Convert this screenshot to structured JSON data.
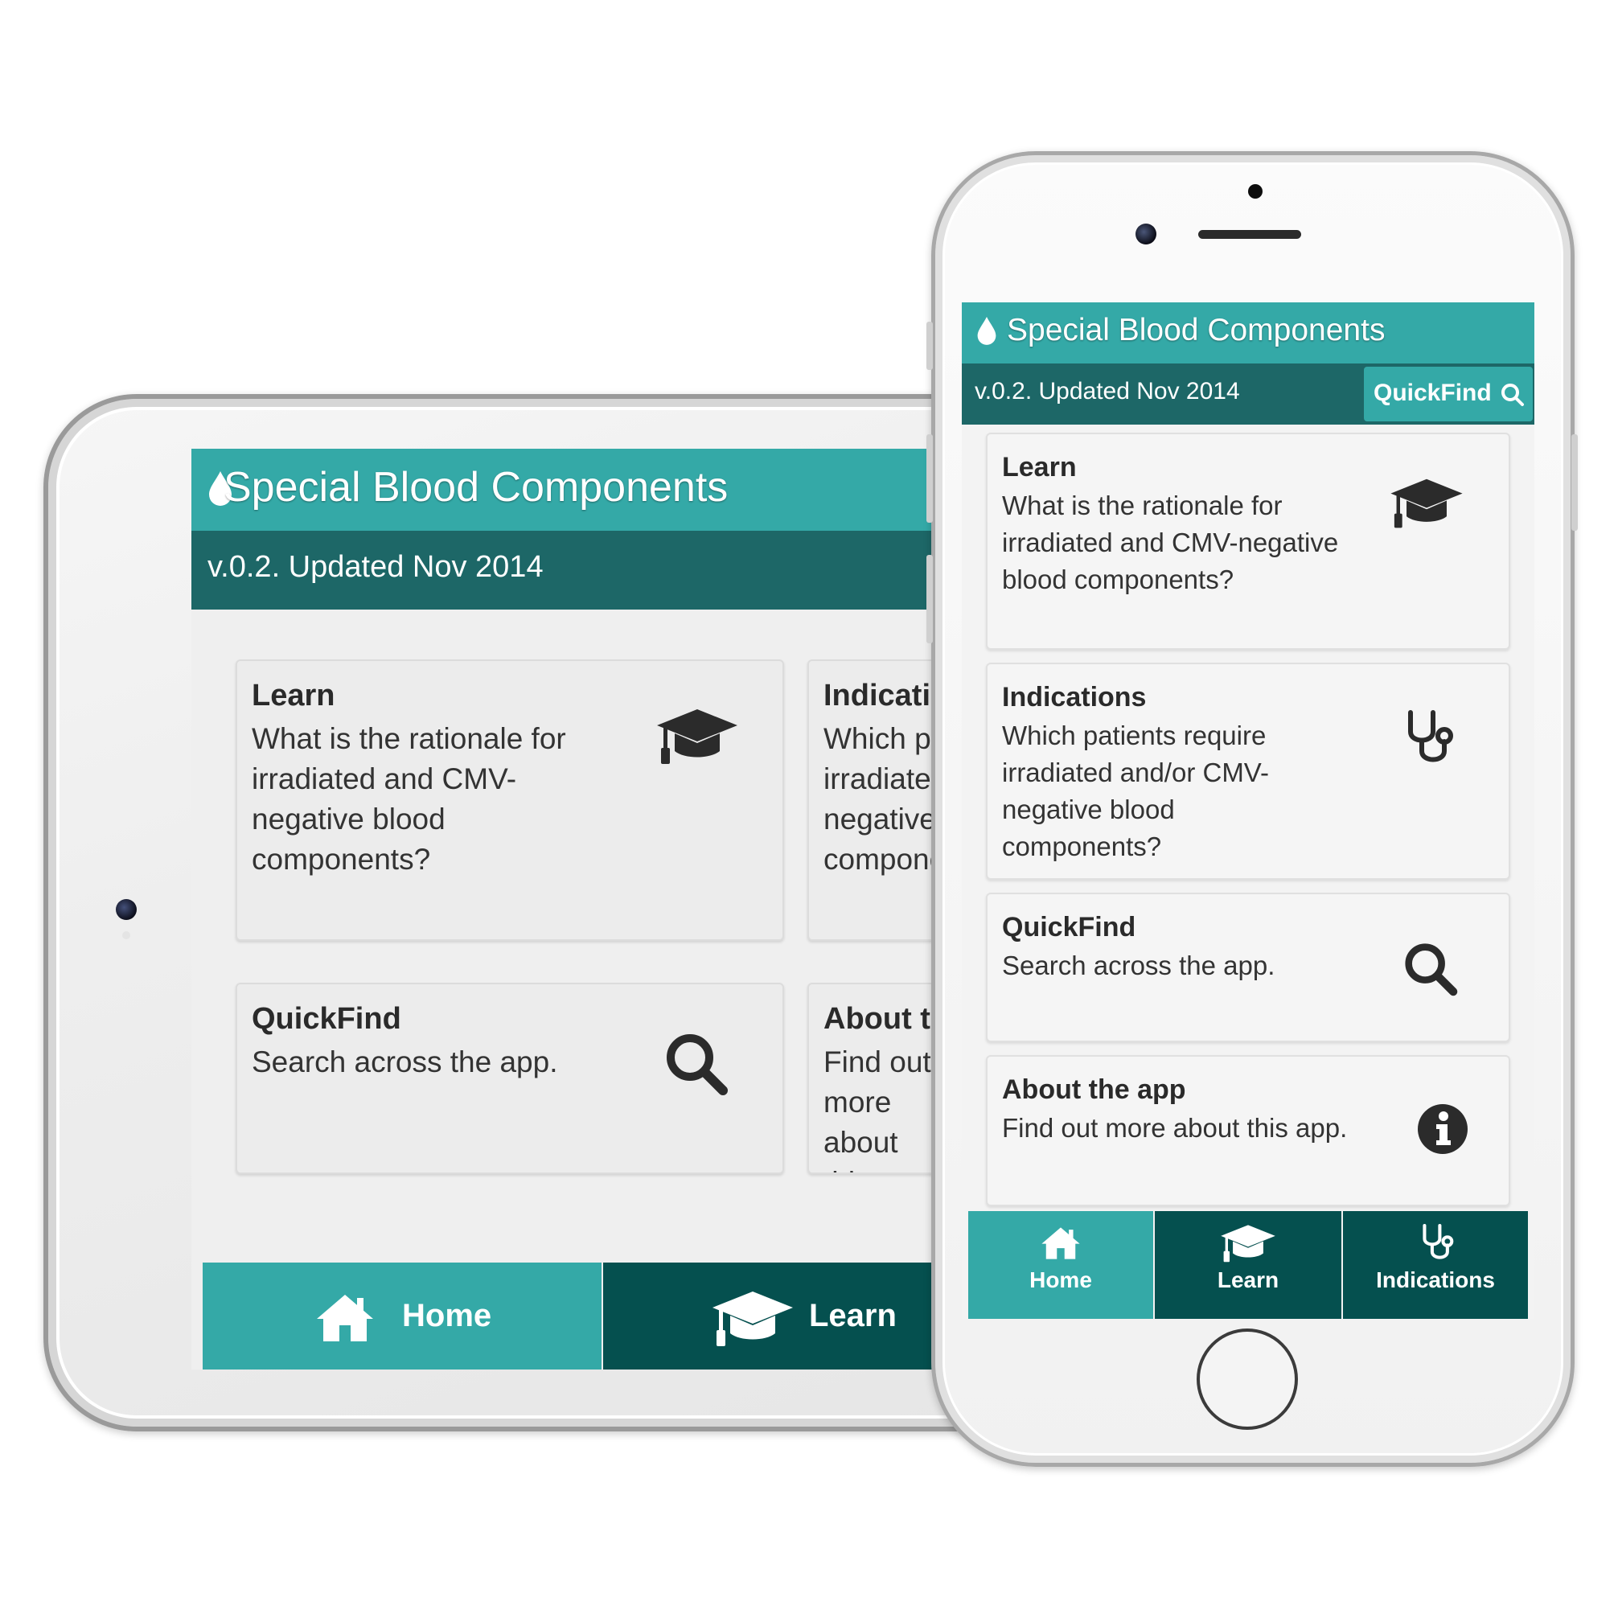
{
  "app": {
    "title": "Special Blood Components",
    "version": "v.0.2. Updated Nov 2014"
  },
  "tablet": {
    "cards": [
      {
        "title": "Learn",
        "desc": "What is the rationale for irradiated and CMV-negative blood components?",
        "icon": "graduation-cap-icon"
      },
      {
        "title": "Indications",
        "desc": "Which patients require irradiated and/or CMV-negative blood components?",
        "icon": "stethoscope-icon"
      },
      {
        "title": "QuickFind",
        "desc": "Search across the app.",
        "icon": "search-icon"
      },
      {
        "title": "About the app",
        "desc": "Find out more about this app.",
        "icon": "info-icon"
      }
    ],
    "nav": [
      {
        "label": "Home",
        "icon": "home-icon",
        "active": true
      },
      {
        "label": "Learn",
        "icon": "graduation-cap-icon",
        "active": false
      }
    ]
  },
  "phone": {
    "quickfind_button": "QuickFind",
    "cards": [
      {
        "title": "Learn",
        "desc": "What is the rationale for irradiated and CMV-negative blood components?",
        "icon": "graduation-cap-icon"
      },
      {
        "title": "Indications",
        "desc": "Which patients require irradiated and/or CMV-negative blood components?",
        "icon": "stethoscope-icon"
      },
      {
        "title": "QuickFind",
        "desc": "Search across the app.",
        "icon": "search-icon"
      },
      {
        "title": "About the app",
        "desc": "Find out more about this app.",
        "icon": "info-icon"
      }
    ],
    "nav": [
      {
        "label": "Home",
        "icon": "home-icon",
        "active": true
      },
      {
        "label": "Learn",
        "icon": "graduation-cap-icon",
        "active": false
      },
      {
        "label": "Indications",
        "icon": "stethoscope-icon",
        "active": false
      }
    ]
  },
  "colors": {
    "header_teal": "#34a9a7",
    "subheader_dark_teal": "#1d6767",
    "nav_active": "#34a9a7",
    "nav_inactive": "#05504f"
  }
}
